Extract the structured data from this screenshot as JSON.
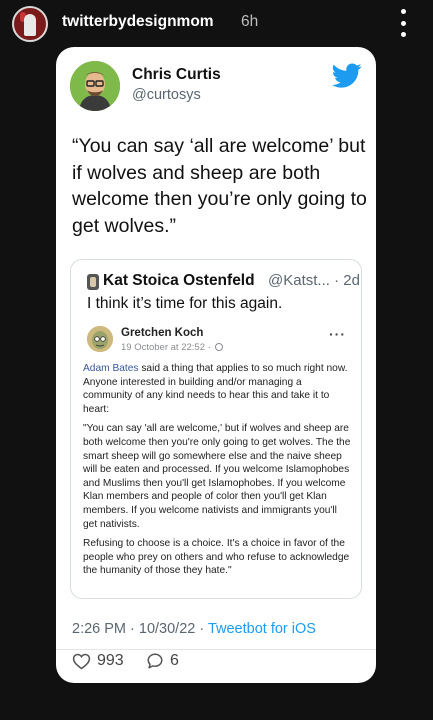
{
  "story": {
    "username": "twitterbydesignmom",
    "time": "6h"
  },
  "tweet": {
    "author_name": "Chris Curtis",
    "author_handle": "@curtosys",
    "text": "“You can say ‘all are welcome’ but if wolves and sheep are both welcome then you’re only going to get wolves.”",
    "timestamp": "2:26 PM · 10/30/22 · ",
    "via": "Tweetbot for iOS",
    "likes": "993",
    "replies": "6"
  },
  "quoted": {
    "author_name": "Kat Stoica Ostenfeld",
    "meta": "@Katst... · 2d",
    "text": "I think it’s time for this again."
  },
  "facebook_post": {
    "author_name": "Gretchen Koch",
    "date": "19 October at 22:52 · ",
    "mention": "Adam Bates",
    "para1_rest": " said a thing that applies to so much right now. Anyone interested in building and/or managing a community of any kind needs to hear this and take it to heart:",
    "para2": "\"You can say 'all are welcome,' but if wolves and sheep are both welcome then you're only going to get wolves. The the smart sheep will go somewhere else and the naive sheep will be eaten and processed. If you welcome Islamophobes and Muslims then you'll get Islamophobes. If you welcome Klan members and people of color then you'll get Klan members. If you welcome nativists and immigrants you'll get nativists.",
    "para3": "Refusing to choose is a choice. It's a choice in favor of the people who prey on others and who refuse to acknowledge the humanity of those they hate.\""
  },
  "colors": {
    "background": "#111111",
    "card": "#ffffff",
    "twitter_blue": "#1d9bf0",
    "muted": "#5b6670"
  },
  "icons": [
    "more-vertical-icon",
    "twitter-bird-icon",
    "heart-icon",
    "reply-bubble-icon",
    "globe-icon",
    "more-horizontal-icon"
  ]
}
